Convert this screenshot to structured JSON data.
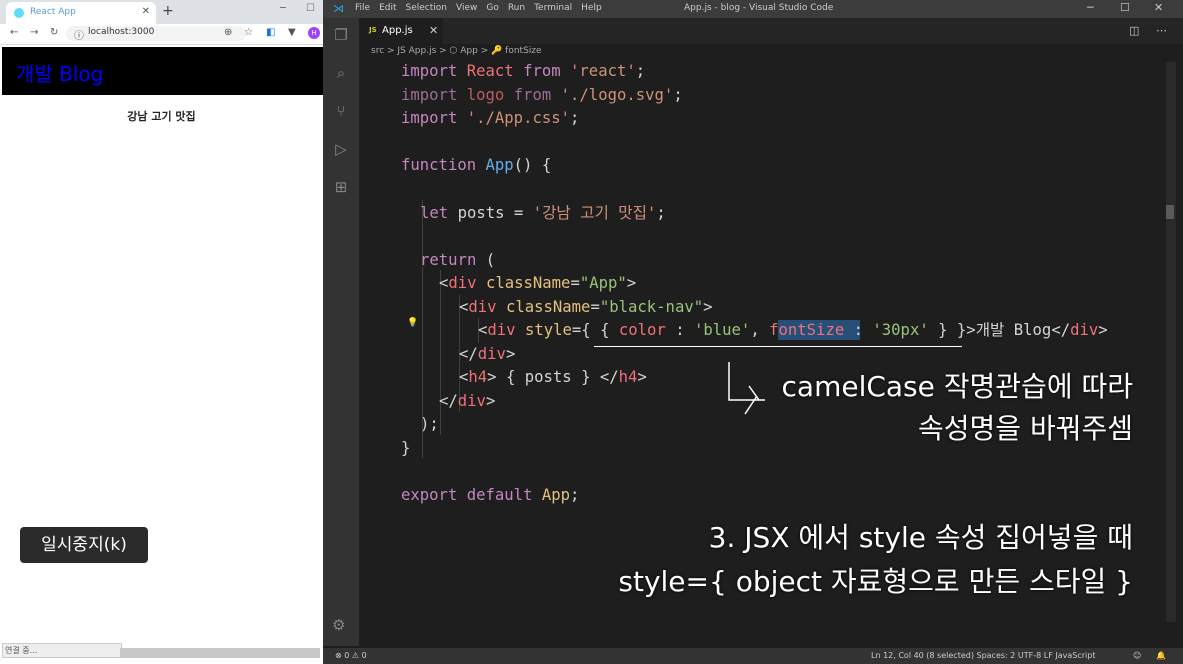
{
  "browser": {
    "tab_title": "React App",
    "url": "localhost:3000",
    "nav_title": "개발 Blog",
    "nav_title_color": "blue",
    "post_title": "강남 고기 맛집",
    "pause_button": "일시중지(k)",
    "status_text": "연결 중..."
  },
  "vscode": {
    "window_title": "App.js - blog - Visual Studio Code",
    "menu": [
      "File",
      "Edit",
      "Selection",
      "View",
      "Go",
      "Run",
      "Terminal",
      "Help"
    ],
    "tab_label": "App.js",
    "tab_badge": "JS",
    "breadcrumb": "src > JS App.js > ⬡ App > 🔑 fontSize",
    "status_left": "⊗ 0 ⚠ 0",
    "status_right": "Ln 12, Col 40 (8 selected)   Spaces: 2   UTF-8   LF   JavaScript"
  },
  "code": {
    "l1_kw": "import",
    "l1_id": "React",
    "l1_from": "from",
    "l1_str": "'react'",
    "l1_end": ";",
    "l2_kw": "import",
    "l2_id": "logo",
    "l2_from": "from",
    "l2_str": "'./logo.svg'",
    "l2_end": ";",
    "l3_kw": "import",
    "l3_str": "'./App.css'",
    "l3_end": ";",
    "l5_kw": "function",
    "l5_fn": "App",
    "l5_rest": "() {",
    "l7_kw": "let",
    "l7_id": "posts",
    "l7_eq": " = ",
    "l7_str": "'강남 고기 맛집'",
    "l7_end": ";",
    "l9_kw": "return",
    "l9_rest": " (",
    "l10_open": "<",
    "l10_tag": "div",
    "l10_attr": "className",
    "l10_eq": "=",
    "l10_val": "\"App\"",
    "l10_close": ">",
    "l11_open": "<",
    "l11_tag": "div",
    "l11_attr": "className",
    "l11_eq": "=",
    "l11_val": "\"black-nav\"",
    "l11_close": ">",
    "l12_open": "<",
    "l12_tag": "div",
    "l12_attr": "style",
    "l12_p1": "={ { ",
    "l12_k1": "color",
    "l12_c1": " : ",
    "l12_v1": "'blue'",
    "l12_comma": ", ",
    "l12_k2": "fontSize",
    "l12_c2": " : ",
    "l12_v2": "'30px'",
    "l12_p2": " } }>",
    "l12_text": "개발 Blog",
    "l12_ctag_open": "</",
    "l12_ctag": "div",
    "l12_ctag_close": ">",
    "l13_open": "</",
    "l13_tag": "div",
    "l13_close": ">",
    "l14_open": "<",
    "l14_tag": "h4",
    "l14_mid": "> { ",
    "l14_id": "posts",
    "l14_mid2": " } </",
    "l14_tag2": "h4",
    "l14_close": ">",
    "l15_open": "</",
    "l15_tag": "div",
    "l15_close": ">",
    "l16": ");",
    "l17": "}",
    "l19_kw": "export",
    "l19_kw2": "default",
    "l19_id": "App",
    "l19_end": ";"
  },
  "annotations": {
    "note1_line1": "camelCase 작명관습에 따라",
    "note1_line2": "속성명을 바꿔주셈",
    "note2_line1": "3. JSX 에서 style 속성 집어넣을 때",
    "note2_line2": "style={ object 자료형으로 만든 스타일 }"
  }
}
